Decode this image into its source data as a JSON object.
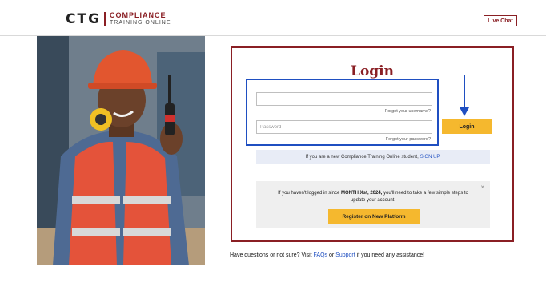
{
  "header": {
    "logo_mark": "CTG",
    "logo_line1": "COMPLIANCE",
    "logo_line2": "TRAINING ONLINE",
    "live_chat_label": "Live Chat"
  },
  "login": {
    "title": "Login",
    "username_value": "",
    "username_placeholder": "",
    "forgot_username": "Forgot your username?",
    "password_placeholder": "Password",
    "forgot_password": "Forgot your password?",
    "login_button": "Login",
    "signup_text": "If you are a new Compliance Training Online student,",
    "signup_link": "SIGN UP.",
    "notice_prefix": "If you haven't logged in since ",
    "notice_bold": "MONTH Xst, 2024,",
    "notice_suffix": " you'll need to take a few simple steps to update your account.",
    "notice_close": "×",
    "register_button": "Register on New Platform"
  },
  "help": {
    "prefix": "Have questions or not sure? Visit ",
    "faqs_link": "FAQs",
    "middle": " or ",
    "support_link": "Support",
    "suffix": " if you need any assistance!"
  },
  "colors": {
    "brand": "#8a1f24",
    "accent": "#f5b82e",
    "highlight": "#1f4fc1"
  },
  "icons": [
    "arrow-down-icon",
    "close-icon"
  ]
}
